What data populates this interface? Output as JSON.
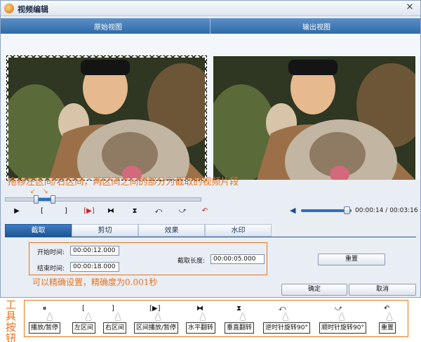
{
  "window": {
    "title": "视频编辑",
    "close": "✕"
  },
  "views": {
    "original": "原始视图",
    "output": "输出视图"
  },
  "annotation_top": "拖移左区间/右区间，两区间之间的部分为截取的视频片段",
  "controls": {
    "play": "▶",
    "left_bracket": "[",
    "right_bracket": "]",
    "range_play": "[▶]",
    "flip_h": "⧓",
    "flip_v": "⧗",
    "rotate_ccw": "⤺",
    "rotate_cw": "⤻",
    "reset": "↶"
  },
  "timeline": {
    "start_fraction": 0.16,
    "end_fraction": 0.24
  },
  "volume": {
    "level_fraction": 0.9
  },
  "time": {
    "current": "00:00:14",
    "total": "00:03:16"
  },
  "tabs": [
    {
      "label": "截取",
      "active": true
    },
    {
      "label": "剪切",
      "active": false
    },
    {
      "label": "效果",
      "active": false
    },
    {
      "label": "水印",
      "active": false
    }
  ],
  "form": {
    "start_label": "开始时间:",
    "start_value": "00:00:12.000",
    "end_label": "结束时间:",
    "end_value": "00:00:18.000",
    "length_label": "截取长度:",
    "length_value": "00:00:05.000",
    "reset_button": "重置"
  },
  "annotation_bottom": "可以精确设置，精确度为0.001秒",
  "footer": {
    "ok": "确定",
    "cancel": "取消"
  },
  "tool_legend": {
    "title": "工具按钮",
    "items": [
      {
        "icon": "⏸",
        "label": "播放/暂停"
      },
      {
        "icon": "[",
        "label": "左区间"
      },
      {
        "icon": "]",
        "label": "右区间"
      },
      {
        "icon": "[▶]",
        "label": "区间播放/暂停"
      },
      {
        "icon": "⧓",
        "label": "水平翻转"
      },
      {
        "icon": "⧗",
        "label": "垂直翻转"
      },
      {
        "icon": "⤺",
        "label": "逆时针旋转90°"
      },
      {
        "icon": "⤻",
        "label": "顺时针旋转90°"
      },
      {
        "icon": "↶",
        "label": "重置"
      }
    ]
  },
  "colors": {
    "accent": "#2c6fc0",
    "annotation": "#e8731c",
    "header": "#2f6aa8"
  }
}
